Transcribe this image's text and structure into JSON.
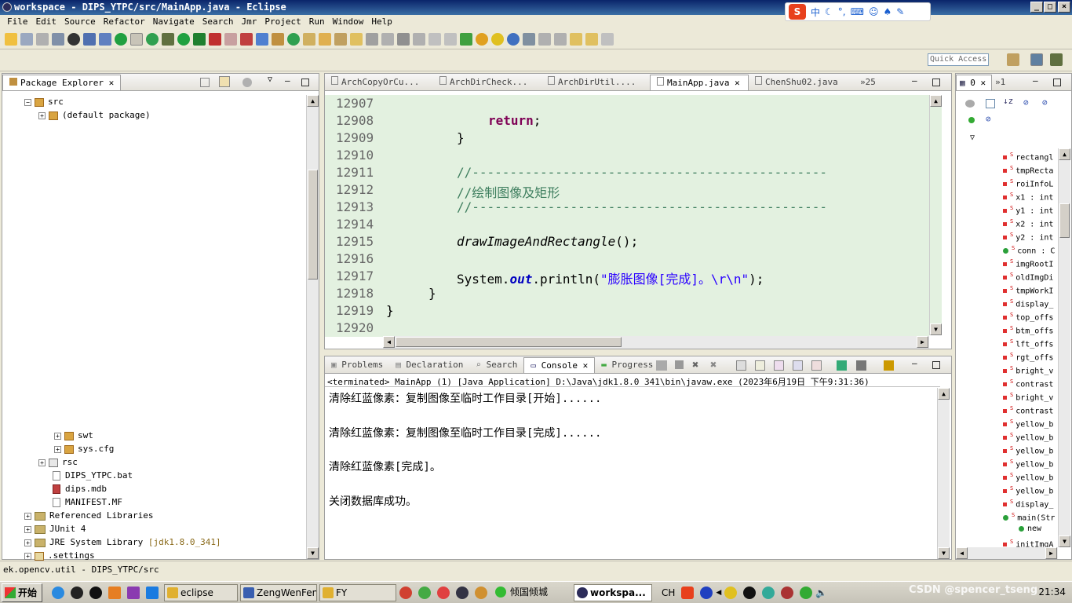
{
  "window": {
    "title": "workspace - DIPS_YTPC/src/MainApp.java - Eclipse"
  },
  "ime": {
    "label": "中"
  },
  "menu": [
    "File",
    "Edit",
    "Source",
    "Refactor",
    "Navigate",
    "Search",
    "Jmr",
    "Project",
    "Run",
    "Window",
    "Help"
  ],
  "quick_access": {
    "placeholder": "Quick Access"
  },
  "package_explorer": {
    "tab": "Package Explorer",
    "top_items": [
      {
        "label": "src"
      },
      {
        "label": "(default package)"
      }
    ],
    "bottom_items": [
      {
        "label": "swt"
      },
      {
        "label": "sys.cfg"
      },
      {
        "label": "rsc"
      },
      {
        "label": "DIPS_YTPC.bat"
      },
      {
        "label": "dips.mdb"
      },
      {
        "label": "MANIFEST.MF"
      },
      {
        "label": "Referenced Libraries"
      },
      {
        "label": "JUnit 4"
      },
      {
        "label": "JRE System Library",
        "suffix": "[jdk1.8.0_341]"
      },
      {
        "label": ".settings"
      }
    ]
  },
  "editor": {
    "tabs": [
      "ArchCopyOrCu...",
      "ArchDirCheck...",
      "ArchDirUtil....",
      "MainApp.java",
      "ChenShu02.java"
    ],
    "overflow": "»25",
    "active_tab": "MainApp.java",
    "lines": [
      {
        "n": "12907",
        "text": ""
      },
      {
        "n": "12908",
        "kw": "return",
        "text": ";"
      },
      {
        "n": "12909",
        "text": "}"
      },
      {
        "n": "12910",
        "text": ""
      },
      {
        "n": "12911",
        "comment": "//-----------------------------------------------"
      },
      {
        "n": "12912",
        "comment": "//绘制图像及矩形"
      },
      {
        "n": "12913",
        "comment": "//-----------------------------------------------"
      },
      {
        "n": "12914",
        "text": ""
      },
      {
        "n": "12915",
        "call": "drawImageAndRectangle",
        "text": "();"
      },
      {
        "n": "12916",
        "text": ""
      },
      {
        "n": "12917",
        "pre": "System.",
        "field": "out",
        "mid": ".println(",
        "str": "\"膨胀图像[完成]。\\r\\n\"",
        "post": ");"
      },
      {
        "n": "12918",
        "text": "}"
      },
      {
        "n": "12919",
        "text": "}"
      },
      {
        "n": "12920",
        "text": ""
      }
    ]
  },
  "console": {
    "tabs": [
      "Problems",
      "Declaration",
      "Search",
      "Console",
      "Progress"
    ],
    "active_tab": "Console",
    "header": "<terminated> MainApp (1) [Java Application] D:\\Java\\jdk1.8.0_341\\bin\\javaw.exe (2023年6月19日 下午9:31:36)",
    "lines": [
      "清除红蓝像素：复制图像至临时工作目录[开始]......",
      "清除红蓝像素：复制图像至临时工作目录[完成]......",
      "清除红蓝像素[完成]。",
      "关闭数据库成功。"
    ]
  },
  "outline": {
    "tab_count": "0",
    "overflow": "»1",
    "items": [
      {
        "label": "rectangl",
        "kind": "field"
      },
      {
        "label": "tmpRecta",
        "kind": "field"
      },
      {
        "label": "roiInfoL",
        "kind": "field"
      },
      {
        "label": "x1 : int",
        "kind": "field"
      },
      {
        "label": "y1 : int",
        "kind": "field"
      },
      {
        "label": "x2 : int",
        "kind": "field"
      },
      {
        "label": "y2 : int",
        "kind": "field"
      },
      {
        "label": "conn : C",
        "kind": "public"
      },
      {
        "label": "imgRootI",
        "kind": "field"
      },
      {
        "label": "oldImgDi",
        "kind": "field"
      },
      {
        "label": "tmpWorkI",
        "kind": "field"
      },
      {
        "label": "display_",
        "kind": "field"
      },
      {
        "label": "top_offs",
        "kind": "field"
      },
      {
        "label": "btm_offs",
        "kind": "field"
      },
      {
        "label": "lft_offs",
        "kind": "field"
      },
      {
        "label": "rgt_offs",
        "kind": "field"
      },
      {
        "label": "bright_v",
        "kind": "field"
      },
      {
        "label": "contrast",
        "kind": "field"
      },
      {
        "label": "bright_v",
        "kind": "field"
      },
      {
        "label": "contrast",
        "kind": "field"
      },
      {
        "label": "yellow_b",
        "kind": "field"
      },
      {
        "label": "yellow_b",
        "kind": "field"
      },
      {
        "label": "yellow_b",
        "kind": "field"
      },
      {
        "label": "yellow_b",
        "kind": "field"
      },
      {
        "label": "yellow_b",
        "kind": "field"
      },
      {
        "label": "yellow_b",
        "kind": "field"
      },
      {
        "label": "display_",
        "kind": "field"
      },
      {
        "label": "main(Str",
        "kind": "public"
      },
      {
        "label": "new",
        "kind": "anon"
      },
      {
        "label": "initImgA",
        "kind": "method"
      }
    ]
  },
  "status": {
    "text": "ek.opencv.util - DIPS_YTPC/src"
  },
  "taskbar": {
    "start": "开始",
    "tasks": [
      "eclipse",
      "ZengWenFeng",
      "FY",
      "倾国倾城",
      "workspa..."
    ],
    "lang": "CH",
    "clock": "21:34",
    "watermark": "CSDN @spencer_tseng"
  },
  "colors": {
    "editor_bg": "#e3f1e0",
    "keyword": "#7f0055",
    "comment": "#3f7f5f",
    "string": "#2a00ff",
    "title_bar": "#0a246a"
  }
}
